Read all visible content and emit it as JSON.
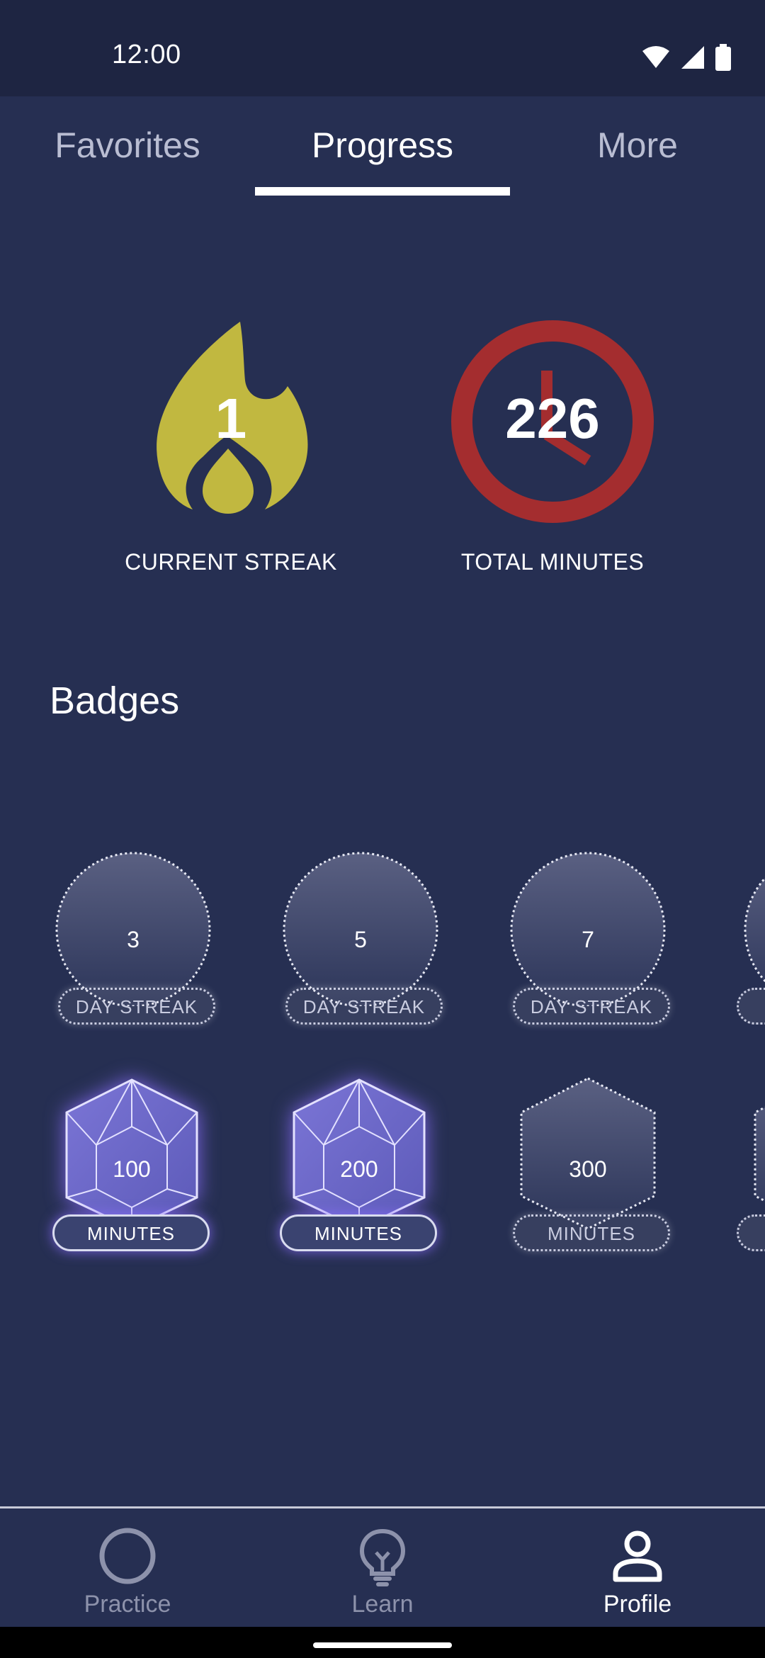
{
  "status_bar": {
    "time": "12:00"
  },
  "tabs": [
    {
      "label": "Favorites",
      "active": false
    },
    {
      "label": "Progress",
      "active": true
    },
    {
      "label": "More",
      "active": false
    }
  ],
  "stats": {
    "streak": {
      "value": "1",
      "label": "CURRENT STREAK",
      "color": "#c1b840"
    },
    "minutes": {
      "value": "226",
      "label": "TOTAL MINUTES",
      "color": "#a42d2f"
    }
  },
  "badges": {
    "title": "Badges",
    "streak_row": [
      {
        "value": "3",
        "label": "DAY STREAK",
        "earned": false
      },
      {
        "value": "5",
        "label": "DAY STREAK",
        "earned": false
      },
      {
        "value": "7",
        "label": "DAY STREAK",
        "earned": false
      }
    ],
    "minutes_row": [
      {
        "value": "100",
        "label": "MINUTES",
        "earned": true
      },
      {
        "value": "200",
        "label": "MINUTES",
        "earned": true
      },
      {
        "value": "300",
        "label": "MINUTES",
        "earned": false
      }
    ]
  },
  "bottom_nav": [
    {
      "label": "Practice",
      "icon": "circle-icon",
      "active": false
    },
    {
      "label": "Learn",
      "icon": "lightbulb-icon",
      "active": false
    },
    {
      "label": "Profile",
      "icon": "person-icon",
      "active": true
    }
  ]
}
